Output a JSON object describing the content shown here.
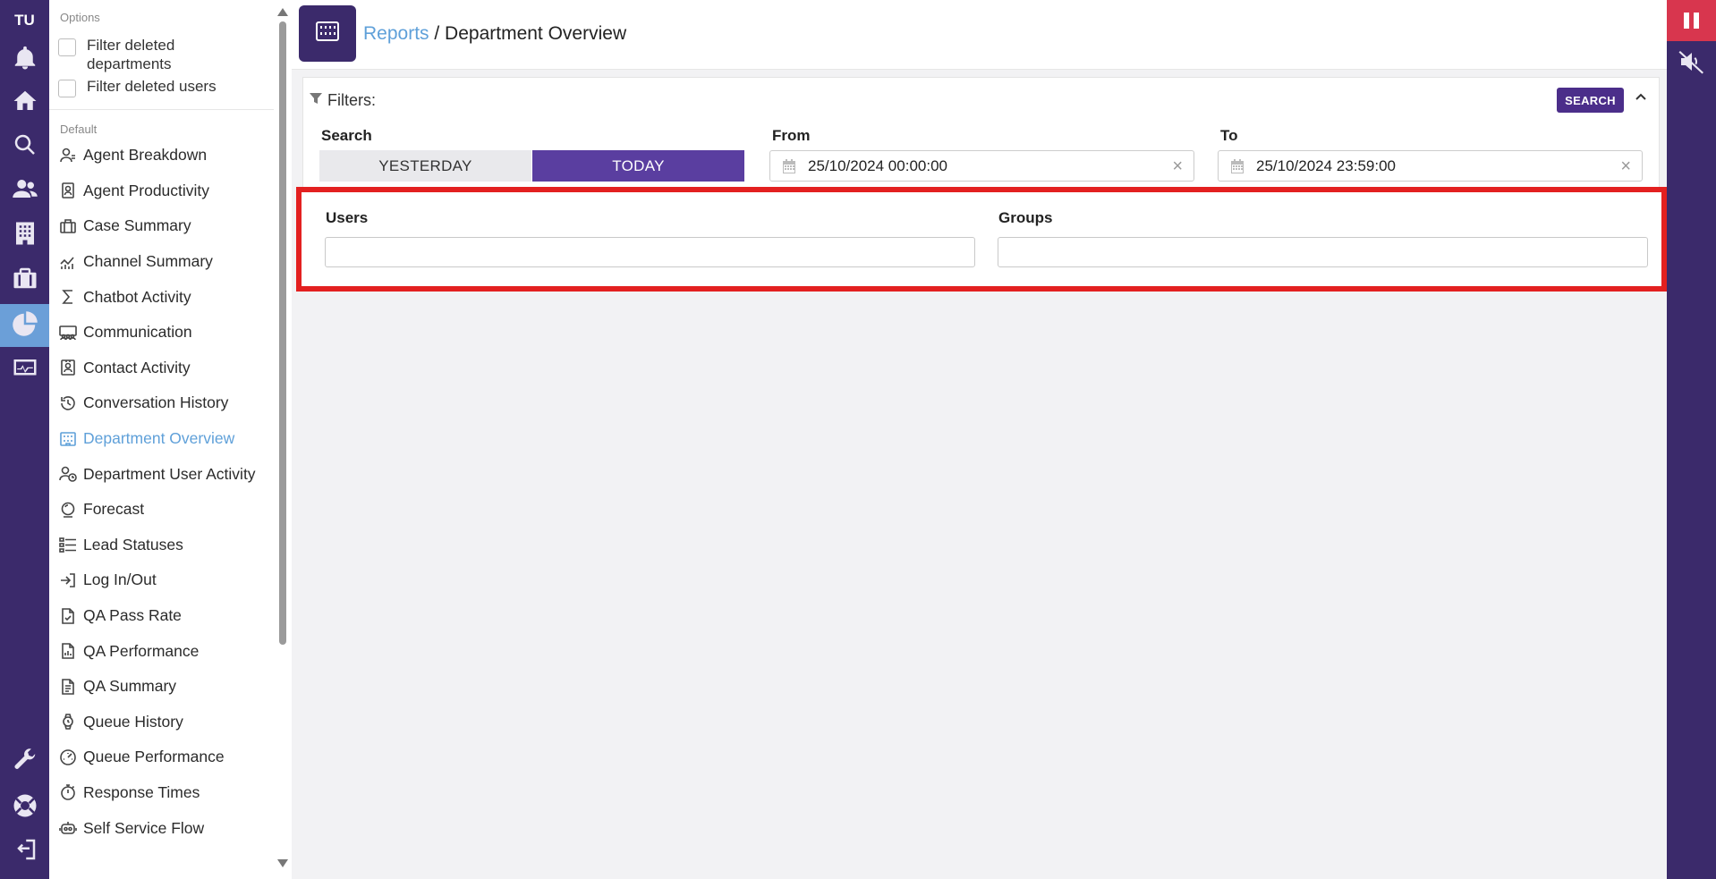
{
  "rail": {
    "brand": "TU",
    "items": [
      {
        "icon": "bell-icon"
      },
      {
        "icon": "home-icon"
      },
      {
        "icon": "search-icon"
      },
      {
        "icon": "users-icon"
      },
      {
        "icon": "building-icon"
      },
      {
        "icon": "briefcase-icon"
      },
      {
        "icon": "pie-chart-icon",
        "active": true
      },
      {
        "icon": "monitor-icon"
      },
      {
        "icon": "wrench-icon"
      },
      {
        "icon": "support-icon"
      },
      {
        "icon": "logout-icon"
      }
    ]
  },
  "sidebar": {
    "options_title": "Options",
    "options": [
      {
        "label": "Filter deleted departments",
        "checked": false
      },
      {
        "label": "Filter deleted users",
        "checked": false
      }
    ],
    "default_title": "Default",
    "items": [
      {
        "label": "Agent Breakdown",
        "icon": "user-icon"
      },
      {
        "label": "Agent Productivity",
        "icon": "badge-icon"
      },
      {
        "label": "Case Summary",
        "icon": "briefcase-icon"
      },
      {
        "label": "Channel Summary",
        "icon": "chart-line-icon"
      },
      {
        "label": "Chatbot Activity",
        "icon": "sigma-icon"
      },
      {
        "label": "Communication",
        "icon": "people-icon"
      },
      {
        "label": "Contact Activity",
        "icon": "contact-icon"
      },
      {
        "label": "Conversation History",
        "icon": "history-icon"
      },
      {
        "label": "Department Overview",
        "icon": "building-icon",
        "active": true
      },
      {
        "label": "Department User Activity",
        "icon": "user-clock-icon"
      },
      {
        "label": "Forecast",
        "icon": "crystal-ball-icon"
      },
      {
        "label": "Lead Statuses",
        "icon": "list-icon"
      },
      {
        "label": "Log In/Out",
        "icon": "login-icon"
      },
      {
        "label": "QA Pass Rate",
        "icon": "file-check-icon"
      },
      {
        "label": "QA Performance",
        "icon": "file-chart-icon"
      },
      {
        "label": "QA Summary",
        "icon": "file-text-icon"
      },
      {
        "label": "Queue History",
        "icon": "watch-icon"
      },
      {
        "label": "Queue Performance",
        "icon": "gauge-icon"
      },
      {
        "label": "Response Times",
        "icon": "stopwatch-icon"
      },
      {
        "label": "Self Service Flow",
        "icon": "robot-icon"
      }
    ]
  },
  "header": {
    "crumb_link": "Reports",
    "crumb_sep": " / ",
    "crumb_current": "Department Overview"
  },
  "filters": {
    "title": "Filters:",
    "search_button": "SEARCH",
    "search_label": "Search",
    "yesterday": "YESTERDAY",
    "today": "TODAY",
    "from_label": "From",
    "from_value": "25/10/2024 00:00:00",
    "to_label": "To",
    "to_value": "25/10/2024 23:59:00",
    "users_label": "Users",
    "groups_label": "Groups"
  },
  "colors": {
    "rail": "#3b2a6b",
    "accent": "#5a3ea0",
    "link": "#5fa0d9",
    "highlight": "#e32020",
    "pause": "#d8364e"
  }
}
